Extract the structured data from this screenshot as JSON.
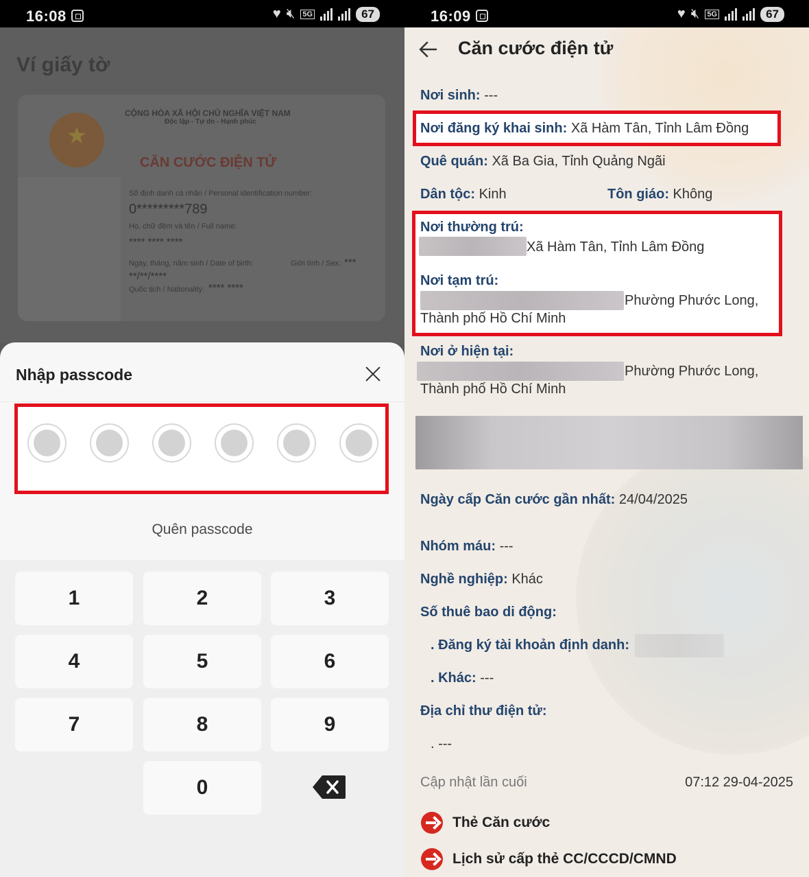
{
  "left_screen": {
    "status_time": "16:08",
    "battery": "67",
    "network": "5G",
    "wallet_title": "Ví giấy tờ",
    "card": {
      "country_line": "CỘNG HÒA XÃ HỘI CHỦ NGHĨA VIỆT NAM",
      "motto_line": "Độc lập - Tự do - Hạnh phúc",
      "card_title": "CĂN CƯỚC ĐIỆN TỬ",
      "id_label": "Số định danh cá nhân / Personal identification number:",
      "id_value": "0*********789",
      "name_label": "Họ, chữ đệm và tên / Full name:",
      "name_value": "**** **** ****",
      "dob_label": "Ngày, tháng, năm sinh / Date of birth:",
      "dob_value": "**/**/****",
      "sex_label": "Giới tính / Sex:",
      "sex_value": "***",
      "nationality_label": "Quốc tịch / Nationality:",
      "nationality_value": "**** ****"
    },
    "sheet": {
      "title": "Nhập passcode",
      "pin_length": 6,
      "forgot": "Quên passcode"
    },
    "keypad": {
      "k1": "1",
      "k2": "2",
      "k3": "3",
      "k4": "4",
      "k5": "5",
      "k6": "6",
      "k7": "7",
      "k8": "8",
      "k9": "9",
      "k0": "0"
    }
  },
  "right_screen": {
    "status_time": "16:09",
    "battery": "67",
    "network": "5G",
    "title": "Căn cước điện tử",
    "fields": {
      "noi_sinh": {
        "label": "Nơi sinh:",
        "value": "---"
      },
      "noi_dang_ky": {
        "label": "Nơi đăng ký khai sinh:",
        "value": "Xã Hàm Tân, Tỉnh Lâm Đồng"
      },
      "que_quan": {
        "label": "Quê quán:",
        "value": "Xã Ba Gia, Tỉnh Quảng Ngãi"
      },
      "dan_toc": {
        "label": "Dân tộc:",
        "value": "Kinh"
      },
      "ton_giao": {
        "label": "Tôn giáo:",
        "value": "Không"
      },
      "thuong_tru": {
        "label": "Nơi thường trú:",
        "value": "Xã Hàm Tân, Tỉnh Lâm Đồng"
      },
      "tam_tru": {
        "label": "Nơi tạm trú:",
        "value_line1": "Phường Phước Long,",
        "value_line2": "Thành phố Hồ Chí Minh"
      },
      "hien_tai": {
        "label": "Nơi ở hiện tại:",
        "value_line1": "Phường Phước Long,",
        "value_line2": "Thành phố Hồ Chí Minh"
      },
      "ngay_cap": {
        "label": "Ngày cấp Căn cước gần nhất:",
        "value": "24/04/2025"
      },
      "nhom_mau": {
        "label": "Nhóm máu:",
        "value": "---"
      },
      "nghe_nghiep": {
        "label": "Nghề nghiệp:",
        "value": "Khác"
      },
      "so_thue_bao": {
        "label": "Số thuê bao di động:"
      },
      "dang_ky_tk": {
        "label": ". Đăng ký tài khoản định danh:"
      },
      "khac": {
        "label": ". Khác:",
        "value": "---"
      },
      "email": {
        "label": "Địa chỉ thư điện tử:",
        "value": ". ---"
      }
    },
    "last_update": {
      "label": "Cập nhật lần cuối",
      "value": "07:12 29-04-2025"
    },
    "links": {
      "the_can_cuoc": "Thẻ Căn cước",
      "lich_su": "Lịch sử cấp thẻ CC/CCCD/CMND"
    },
    "colors": {
      "highlight_border": "#e3101c",
      "label_blue": "#24456d",
      "link_icon": "#d6281f"
    }
  }
}
